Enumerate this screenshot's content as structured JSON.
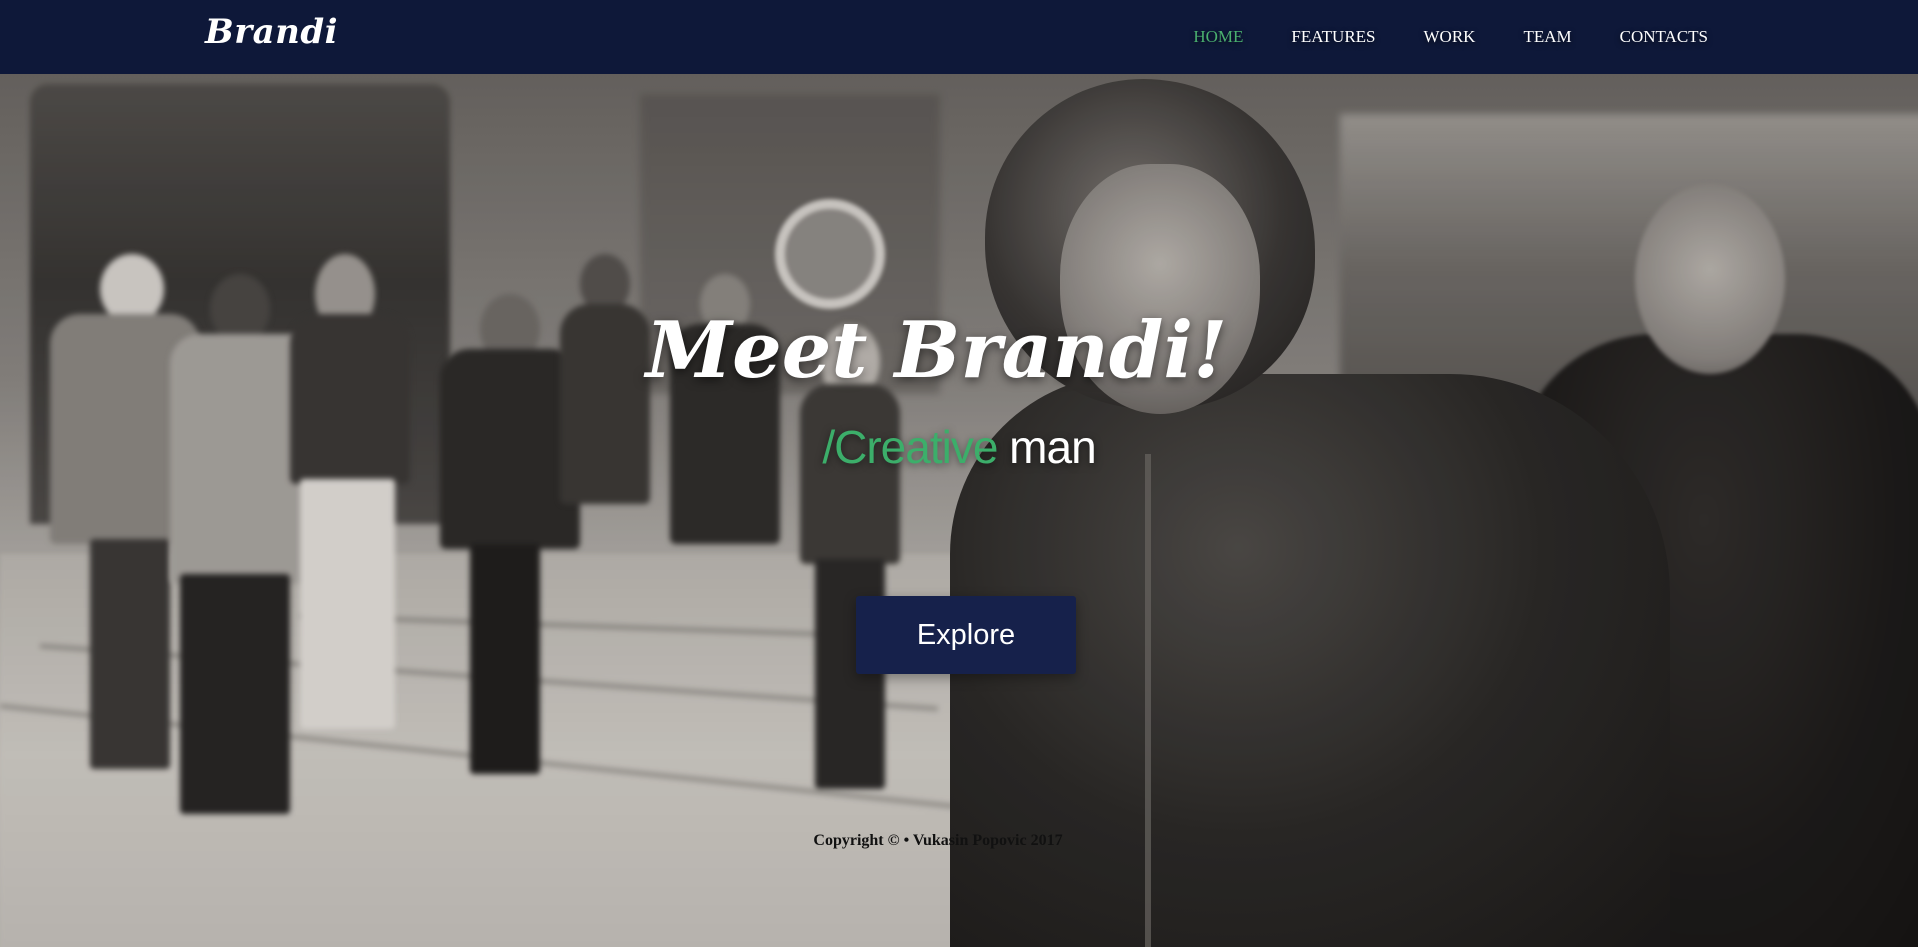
{
  "nav": {
    "logo": "Brandi",
    "items": [
      {
        "label": "HOME",
        "active": true
      },
      {
        "label": "FEATURES",
        "active": false
      },
      {
        "label": "WORK",
        "active": false
      },
      {
        "label": "TEAM",
        "active": false
      },
      {
        "label": "CONTACTS",
        "active": false
      }
    ]
  },
  "hero": {
    "title": "Meet Brandi!",
    "subtitle_prefix": "/Creative",
    "subtitle_suffix": " man",
    "button_label": "Explore"
  },
  "footer": {
    "copyright": "Copyright © • Vukasin Popovic 2017"
  },
  "colors": {
    "navbar_bg": "#0e1839",
    "accent_green": "#4aaf6e",
    "button_bg": "#16214b",
    "text_white": "#ffffff"
  }
}
